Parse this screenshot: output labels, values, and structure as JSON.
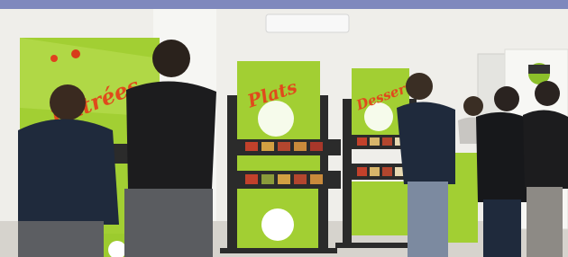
{
  "photo": {
    "signs": {
      "entrees": "Entrées",
      "plats": "Plats",
      "desserts": "Desserts"
    }
  },
  "colors": {
    "header_bar": "#7f88bd",
    "kiosk_green": "#9ccb2e",
    "kiosk_frame": "#2b2b2b",
    "wall": "#f1f1ee",
    "floor": "#d9d6d0",
    "shirt_navy": "#1f2a3c"
  }
}
